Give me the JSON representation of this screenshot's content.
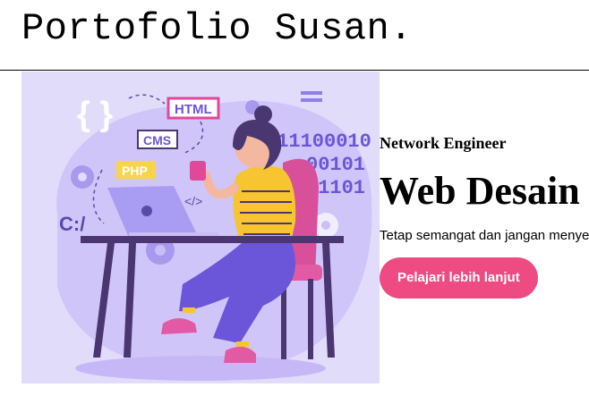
{
  "header": {
    "title": "Portofolio Susan."
  },
  "hero": {
    "subtitle": "Network Engineer",
    "title": "Web Desain",
    "tagline": "Tetap semangat dan jangan menyerah",
    "cta_label": "Pelajari lebih lanjut",
    "illustration": {
      "labels": {
        "braces": "{ }",
        "html": "HTML",
        "cms": "CMS",
        "php": "PHP",
        "path": "C:/",
        "tag": "</>",
        "binary_1": "011100010",
        "binary_2": "00101",
        "binary_3": "01101"
      }
    }
  },
  "colors": {
    "accent": "#ee4b83",
    "illustration_bg": "#e2dcfb",
    "illustration_blob": "#c6b8f7",
    "shirt": "#f7c531",
    "pants": "#6b56d9",
    "chair": "#d8509a",
    "desk": "#4a3670",
    "laptop": "#a99cf3"
  }
}
